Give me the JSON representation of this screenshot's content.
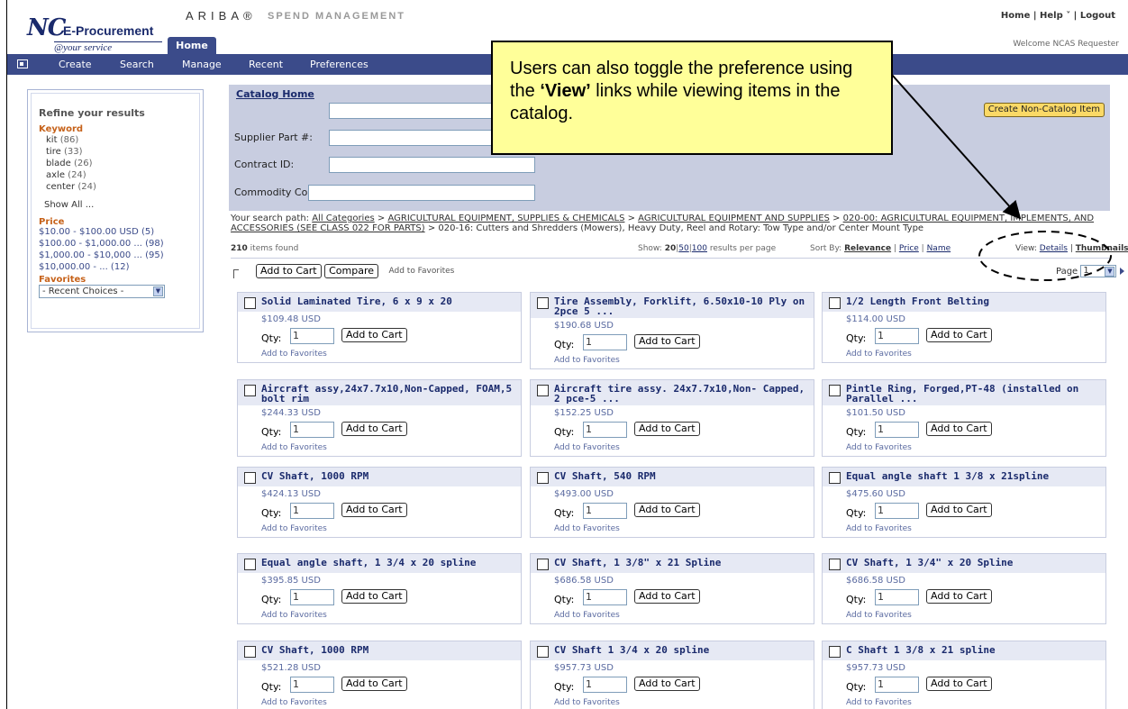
{
  "header": {
    "logo_nc": "NC",
    "logo_ep": "E-Procurement",
    "logo_sub": "@your service",
    "ariba": "ARIBA®",
    "spend": "SPEND MANAGEMENT",
    "links": {
      "home": "Home",
      "help": "Help ˅",
      "logout": "Logout"
    },
    "welcome": "Welcome NCAS Requester",
    "home_tab": "Home"
  },
  "nav": {
    "create": "Create",
    "search": "Search",
    "manage": "Manage",
    "recent": "Recent",
    "preferences": "Preferences"
  },
  "sidebar": {
    "title": "Refine your results",
    "keyword_head": "Keyword",
    "keywords": [
      {
        "label": "kit",
        "count": "(86)"
      },
      {
        "label": "tire",
        "count": "(33)"
      },
      {
        "label": "blade",
        "count": "(26)"
      },
      {
        "label": "axle",
        "count": "(24)"
      },
      {
        "label": "center",
        "count": "(24)"
      }
    ],
    "show_all": "Show All ...",
    "price_head": "Price",
    "prices": [
      "$10.00 - $100.00 USD (5)",
      "$100.00 - $1,000.00 ... (98)",
      "$1,000.00 - $10,000 ... (95)",
      "$10,000.00 - ... (12)"
    ],
    "favorites_head": "Favorites",
    "favorites_select": "- Recent Choices -"
  },
  "search": {
    "catalog_home": "Catalog Home",
    "supplier_label": "Supplier Part #:",
    "contract_label": "Contract ID:",
    "commodity_label": "Commodity Code:",
    "keyword_value": "",
    "create_button": "Create Non-Catalog Item"
  },
  "path": {
    "prefix": "Your search path:",
    "crumbs": [
      "All Categories",
      "AGRICULTURAL EQUIPMENT, SUPPLIES & CHEMICALS",
      "AGRICULTURAL EQUIPMENT AND SUPPLIES",
      "020-00: AGRICULTURAL EQUIPMENT, IMPLEMENTS, AND ACCESSORIES (SEE CLASS 022 FOR PARTS)"
    ],
    "current": "020-16: Cutters and Shredders (Mowers), Heavy Duty, Reel and Rotary: Tow Type and/or Center Mount Type"
  },
  "results": {
    "count": "210",
    "found": "items found",
    "show_label": "Show:",
    "show_20": "20",
    "show_50": "50",
    "show_100": "100",
    "per_page": "results per page",
    "sort_label": "Sort By:",
    "sort_relevance": "Relevance",
    "sort_price": "Price",
    "sort_name": "Name",
    "view_label": "View:",
    "view_details": "Details",
    "view_thumbnails": "Thumbnails",
    "page_label": "Page",
    "page_value": "1"
  },
  "actions": {
    "add_to_cart": "Add to Cart",
    "compare": "Compare",
    "add_to_favorites": "Add to Favorites"
  },
  "items": [
    {
      "title": "Solid Laminated Tire, 6 x 9 x 20",
      "price": "$109.48 USD"
    },
    {
      "title": "Tire Assembly, Forklift, 6.50x10-10 Ply on 2pce 5 ...",
      "price": "$190.68 USD"
    },
    {
      "title": "1/2 Length Front Belting",
      "price": "$114.00 USD"
    },
    {
      "title": "Aircraft assy,24x7.7x10,Non-Capped, FOAM,5 bolt rim",
      "price": "$244.33 USD"
    },
    {
      "title": "Aircraft tire assy. 24x7.7x10,Non- Capped, 2 pce-5 ...",
      "price": "$152.25 USD"
    },
    {
      "title": "Pintle Ring, Forged,PT-48 (installed on Parallel ...",
      "price": "$101.50 USD"
    },
    {
      "title": "CV Shaft, 1000 RPM",
      "price": "$424.13 USD"
    },
    {
      "title": "CV Shaft, 540 RPM",
      "price": "$493.00 USD"
    },
    {
      "title": "Equal angle shaft 1 3/8 x 21spline",
      "price": "$475.60 USD"
    },
    {
      "title": "Equal angle shaft, 1 3/4 x 20 spline",
      "price": "$395.85 USD"
    },
    {
      "title": "CV Shaft, 1 3/8\" x 21 Spline",
      "price": "$686.58 USD"
    },
    {
      "title": "CV Shaft, 1 3/4\" x 20 Spline",
      "price": "$686.58 USD"
    },
    {
      "title": "CV Shaft, 1000 RPM",
      "price": "$521.28 USD"
    },
    {
      "title": "CV Shaft 1 3/4 x 20 spline",
      "price": "$957.73 USD"
    },
    {
      "title": "C Shaft 1 3/8 x 21 spline",
      "price": "$957.73 USD"
    }
  ],
  "item_common": {
    "qty_label": "Qty:",
    "qty_value": "1",
    "add_to_cart": "Add to Cart",
    "add_to_favorites": "Add to Favorites"
  },
  "callout": {
    "text_before": "Users can also toggle the preference using the ",
    "text_bold": "‘View’",
    "text_after": " links while viewing items in the catalog."
  },
  "colors": {
    "nav_bg": "#3b4b8a",
    "panel_bg": "#c8cde0",
    "callout_bg": "#ffff99",
    "create_btn": "#fbd966",
    "sidebar_head": "#c6621a"
  }
}
